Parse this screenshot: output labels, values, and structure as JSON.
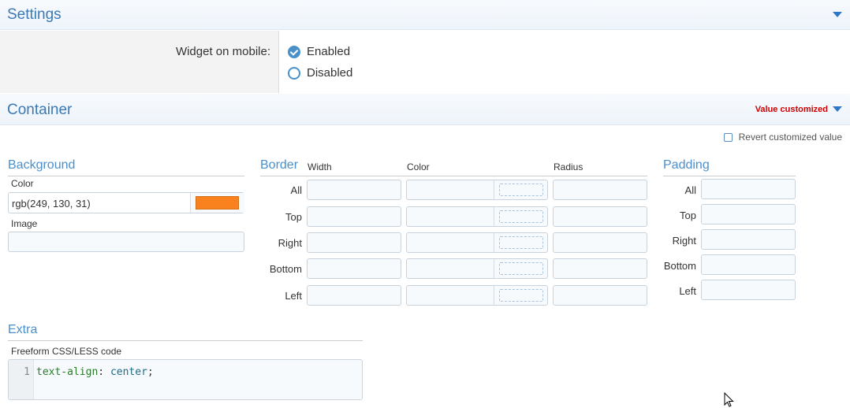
{
  "settings": {
    "title": "Settings",
    "widget_mobile_label": "Widget on mobile:",
    "options": [
      "Enabled",
      "Disabled"
    ],
    "selected": "Enabled"
  },
  "container": {
    "title": "Container",
    "value_customized": "Value customized",
    "revert_label": "Revert customized value",
    "background": {
      "title": "Background",
      "color_label": "Color",
      "color_value": "rgb(249, 130, 31)",
      "swatch_color": "#f9821f",
      "image_label": "Image"
    },
    "border": {
      "title": "Border",
      "col_width": "Width",
      "col_color": "Color",
      "col_radius": "Radius",
      "rows": [
        "All",
        "Top",
        "Right",
        "Bottom",
        "Left"
      ]
    },
    "padding": {
      "title": "Padding",
      "rows": [
        "All",
        "Top",
        "Right",
        "Bottom",
        "Left"
      ]
    },
    "extra": {
      "title": "Extra",
      "code_label": "Freeform CSS/LESS code",
      "line_number": "1",
      "code_property": "text-align",
      "code_colon": ":",
      "code_value": "center",
      "code_semicolon": ";"
    }
  },
  "colors": {
    "accent": "#3b79b6",
    "customized": "#d00000",
    "code_property": "#2a7a2a",
    "code_value": "#1a6b8a"
  }
}
